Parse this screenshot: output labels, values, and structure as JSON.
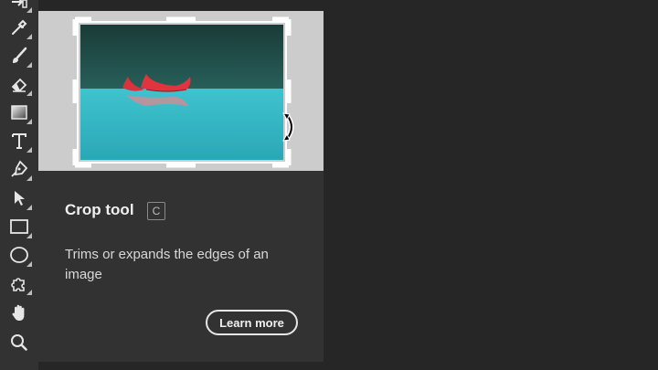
{
  "toolbar": {
    "tools": [
      {
        "name": "move-tool",
        "icon": "move-icon"
      },
      {
        "name": "eyedropper-tool",
        "icon": "eyedropper-icon"
      },
      {
        "name": "brush-tool",
        "icon": "brush-icon"
      },
      {
        "name": "eraser-tool",
        "icon": "eraser-icon"
      },
      {
        "name": "gradient-tool",
        "icon": "gradient-icon"
      },
      {
        "name": "type-tool",
        "icon": "type-icon"
      },
      {
        "name": "pen-tool",
        "icon": "pen-icon"
      },
      {
        "name": "selection-tool",
        "icon": "arrow-icon"
      },
      {
        "name": "rectangle-tool",
        "icon": "rectangle-icon"
      },
      {
        "name": "ellipse-tool",
        "icon": "ellipse-icon"
      },
      {
        "name": "custom-shape-tool",
        "icon": "puzzle-icon"
      },
      {
        "name": "hand-tool",
        "icon": "hand-icon"
      },
      {
        "name": "zoom-tool",
        "icon": "magnifier-icon"
      }
    ]
  },
  "tooltip": {
    "title": "Crop tool",
    "shortcut": "C",
    "description": "Trims or expands the edges of an image",
    "learn_more_label": "Learn more"
  },
  "colors": {
    "toolbar_bg": "#323232",
    "workspace_bg": "#262626",
    "preview_bg": "#cccccc",
    "lake": "#36b6c4",
    "forest": "#1f4a45",
    "canoe": "#d9333c"
  }
}
